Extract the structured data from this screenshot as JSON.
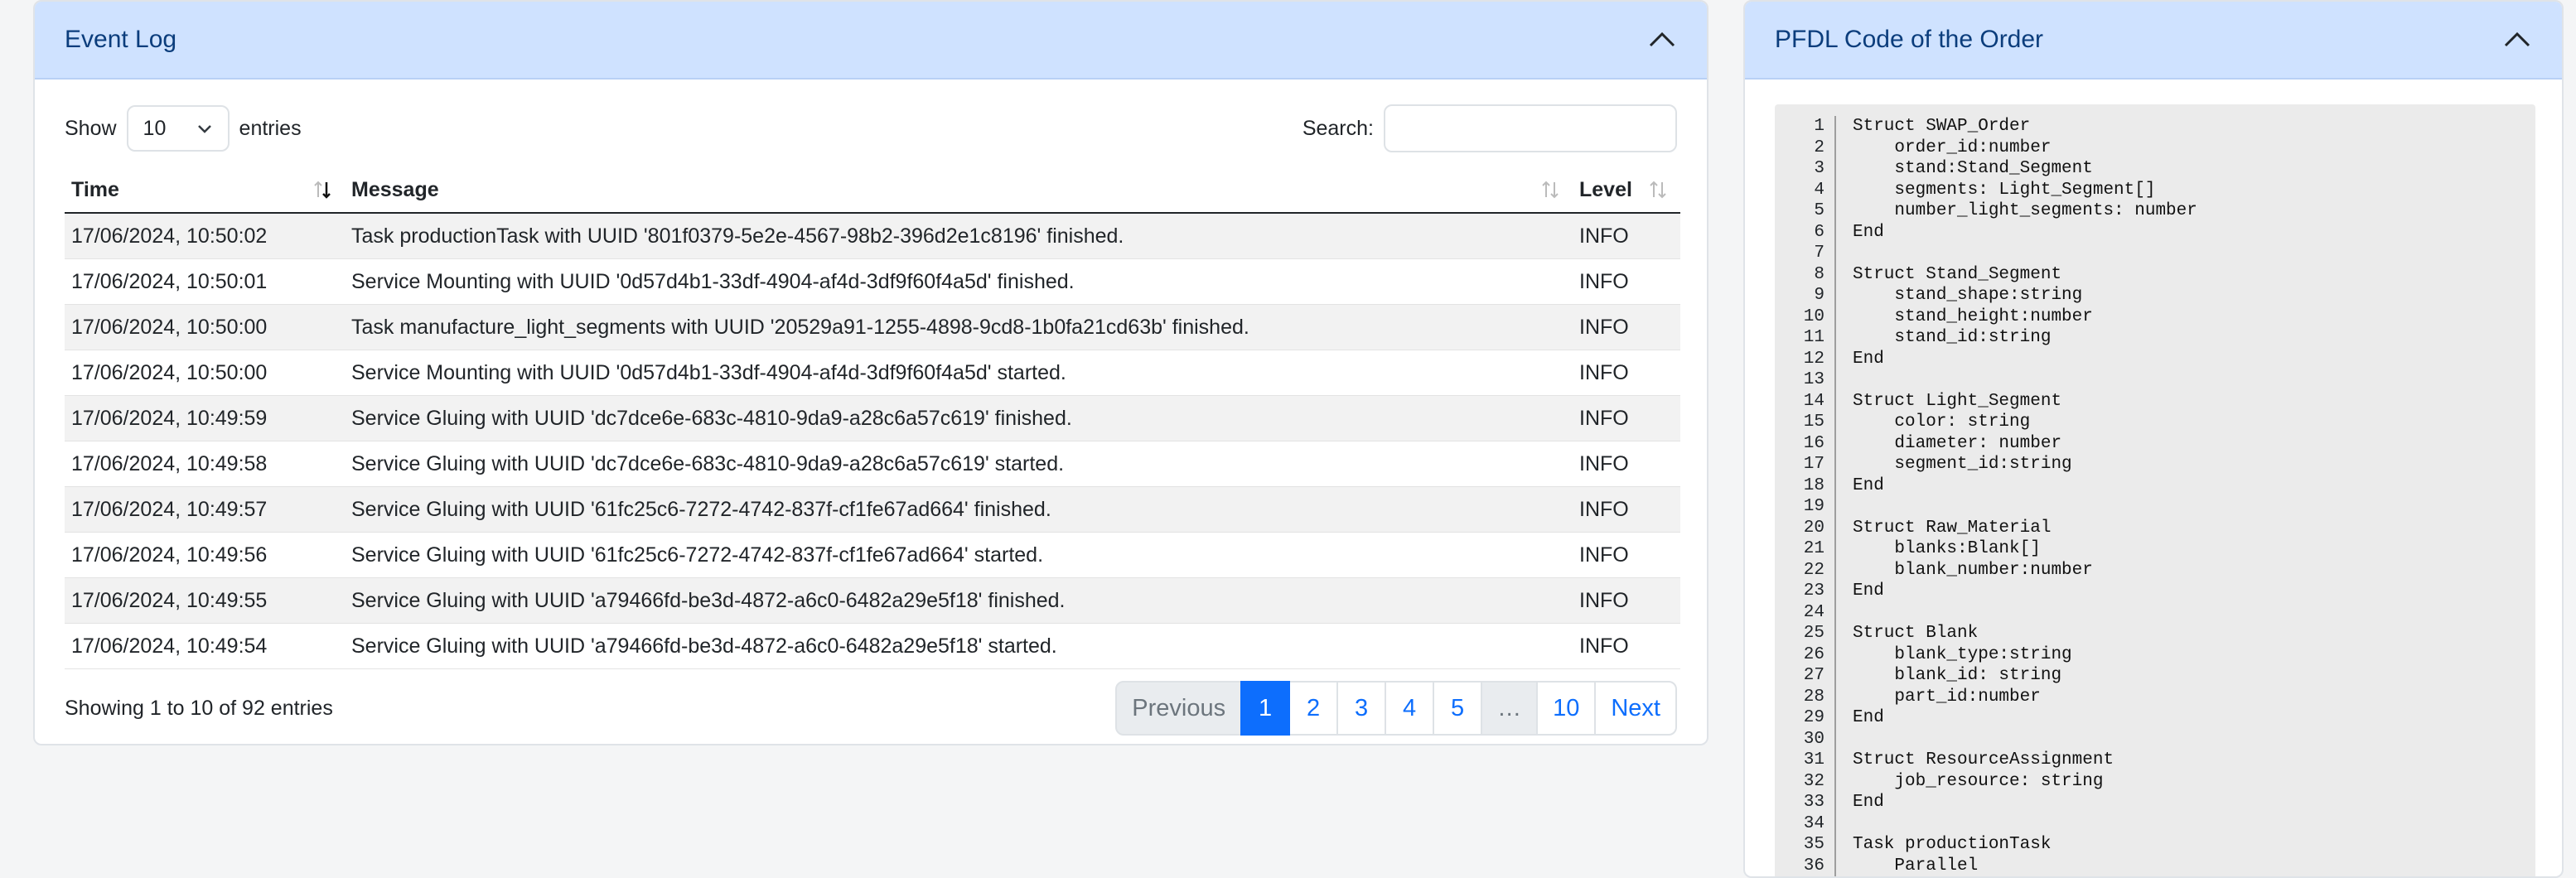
{
  "event_log": {
    "title": "Event Log",
    "show_label": "Show",
    "page_length": "10",
    "entries_label": "entries",
    "search_label": "Search:",
    "search_value": "",
    "columns": [
      "Time",
      "Message",
      "Level"
    ],
    "rows": [
      {
        "time": "17/06/2024, 10:50:02",
        "message": "Task productionTask with UUID '801f0379-5e2e-4567-98b2-396d2e1c8196' finished.",
        "level": "INFO"
      },
      {
        "time": "17/06/2024, 10:50:01",
        "message": "Service Mounting with UUID '0d57d4b1-33df-4904-af4d-3df9f60f4a5d' finished.",
        "level": "INFO"
      },
      {
        "time": "17/06/2024, 10:50:00",
        "message": "Task manufacture_light_segments with UUID '20529a91-1255-4898-9cd8-1b0fa21cd63b' finished.",
        "level": "INFO"
      },
      {
        "time": "17/06/2024, 10:50:00",
        "message": "Service Mounting with UUID '0d57d4b1-33df-4904-af4d-3df9f60f4a5d' started.",
        "level": "INFO"
      },
      {
        "time": "17/06/2024, 10:49:59",
        "message": "Service Gluing with UUID 'dc7dce6e-683c-4810-9da9-a28c6a57c619' finished.",
        "level": "INFO"
      },
      {
        "time": "17/06/2024, 10:49:58",
        "message": "Service Gluing with UUID 'dc7dce6e-683c-4810-9da9-a28c6a57c619' started.",
        "level": "INFO"
      },
      {
        "time": "17/06/2024, 10:49:57",
        "message": "Service Gluing with UUID '61fc25c6-7272-4742-837f-cf1fe67ad664' finished.",
        "level": "INFO"
      },
      {
        "time": "17/06/2024, 10:49:56",
        "message": "Service Gluing with UUID '61fc25c6-7272-4742-837f-cf1fe67ad664' started.",
        "level": "INFO"
      },
      {
        "time": "17/06/2024, 10:49:55",
        "message": "Service Gluing with UUID 'a79466fd-be3d-4872-a6c0-6482a29e5f18' finished.",
        "level": "INFO"
      },
      {
        "time": "17/06/2024, 10:49:54",
        "message": "Service Gluing with UUID 'a79466fd-be3d-4872-a6c0-6482a29e5f18' started.",
        "level": "INFO"
      }
    ],
    "info": "Showing 1 to 10 of 92 entries",
    "pagination": {
      "previous": "Previous",
      "pages": [
        "1",
        "2",
        "3",
        "4",
        "5",
        "…",
        "10"
      ],
      "active": "1",
      "next": "Next"
    }
  },
  "pfdl": {
    "title": "PFDL Code of the Order",
    "code_lines": [
      "Struct SWAP_Order",
      "    order_id:number",
      "    stand:Stand_Segment",
      "    segments: Light_Segment[]",
      "    number_light_segments: number",
      "End",
      "",
      "Struct Stand_Segment",
      "    stand_shape:string",
      "    stand_height:number",
      "    stand_id:string",
      "End",
      "",
      "Struct Light_Segment",
      "    color: string",
      "    diameter: number",
      "    segment_id:string",
      "End",
      "",
      "Struct Raw_Material",
      "    blanks:Blank[]",
      "    blank_number:number",
      "End",
      "",
      "Struct Blank",
      "    blank_type:string",
      "    blank_id: string",
      "    part_id:number",
      "End",
      "",
      "Struct ResourceAssignment",
      "    job_resource: string",
      "End",
      "",
      "Task productionTask",
      "    Parallel"
    ]
  },
  "colors": {
    "header_bg": "#cfe2ff",
    "header_text": "#0b3d7c",
    "accent": "#0d6efd",
    "code_bg": "#ebebeb"
  }
}
